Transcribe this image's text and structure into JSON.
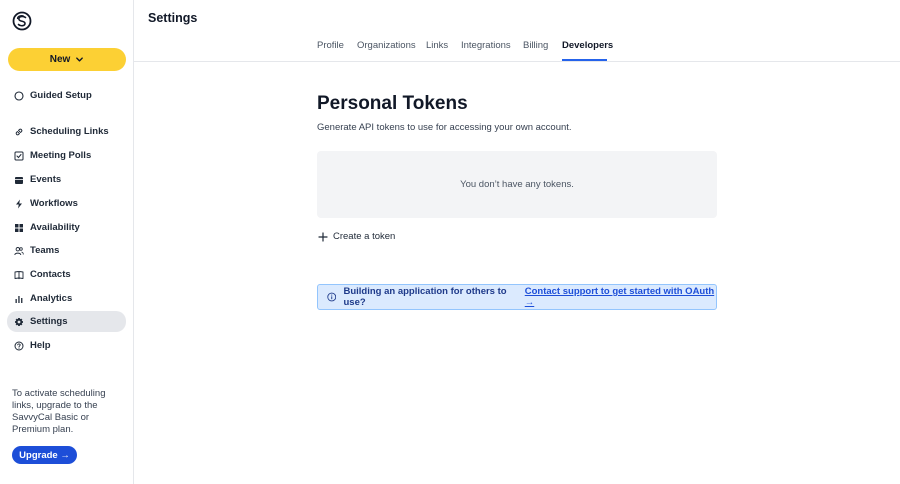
{
  "app": {
    "logo": "savvycal-logo",
    "accent": "#fcd034",
    "link_color": "#1d4ed8"
  },
  "sidebar": {
    "new_label": "New",
    "items": [
      {
        "label": "Guided Setup",
        "icon": "circle-icon"
      },
      {
        "label": "Scheduling Links",
        "icon": "link-icon"
      },
      {
        "label": "Meeting Polls",
        "icon": "poll-icon"
      },
      {
        "label": "Events",
        "icon": "calendar-icon"
      },
      {
        "label": "Workflows",
        "icon": "bolt-icon"
      },
      {
        "label": "Availability",
        "icon": "grid-icon"
      },
      {
        "label": "Teams",
        "icon": "users-icon"
      },
      {
        "label": "Contacts",
        "icon": "book-icon"
      },
      {
        "label": "Analytics",
        "icon": "bar-chart-icon"
      },
      {
        "label": "Settings",
        "icon": "gear-icon",
        "active": true
      },
      {
        "label": "Help",
        "icon": "help-icon"
      }
    ],
    "upgrade_text": "To activate scheduling links, upgrade to the SavvyCal Basic or Premium plan.",
    "upgrade_label": "Upgrade →"
  },
  "header": {
    "title": "Settings",
    "tabs": [
      {
        "label": "Profile"
      },
      {
        "label": "Organizations"
      },
      {
        "label": "Links"
      },
      {
        "label": "Integrations"
      },
      {
        "label": "Billing"
      },
      {
        "label": "Developers",
        "active": true
      }
    ]
  },
  "main": {
    "title": "Personal Tokens",
    "subtitle": "Generate API tokens to use for accessing your own account.",
    "empty_text": "You don’t have any tokens.",
    "create_label": "Create a token",
    "info_text": "Building an application for others to use?",
    "info_link": "Contact support to get started with OAuth →"
  }
}
